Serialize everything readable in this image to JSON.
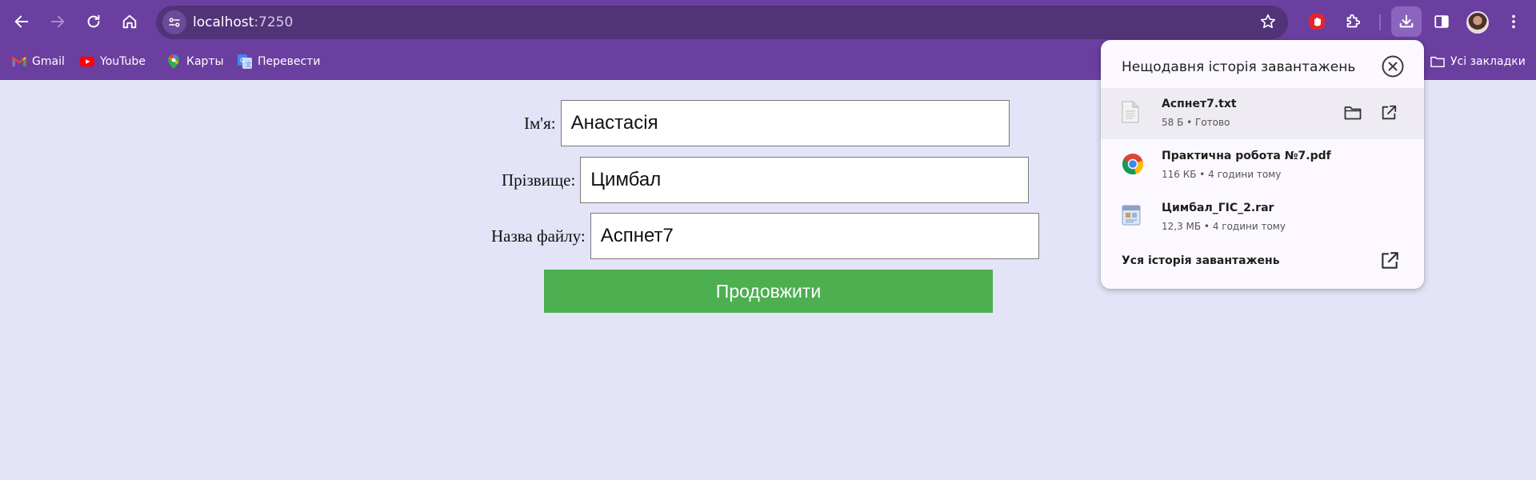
{
  "browser": {
    "url_host": "localhost",
    "url_port": ":7250",
    "bookmarks": [
      {
        "label": "Gmail",
        "icon": "gmail-icon"
      },
      {
        "label": "YouTube",
        "icon": "youtube-icon"
      },
      {
        "label": "Карты",
        "icon": "maps-icon"
      },
      {
        "label": "Перевести",
        "icon": "translate-icon"
      }
    ],
    "all_bookmarks_label": "Усі закладки",
    "colors": {
      "frame": "#6a3fa0",
      "omnibox": "#513478"
    }
  },
  "form": {
    "first_name": {
      "label": "Ім'я:",
      "value": "Анастасія"
    },
    "last_name": {
      "label": "Прізвище:",
      "value": "Цимбал"
    },
    "file_name": {
      "label": "Назва файлу:",
      "value": "Аспнет7"
    },
    "submit_label": "Продовжити",
    "submit_color": "#4caf50",
    "page_background": "#e4e4f8"
  },
  "downloads": {
    "title": "Нещодавня історія завантажень",
    "items": [
      {
        "name": "Аспнет7.txt",
        "meta": "58 Б • Готово",
        "icon": "text-file-icon"
      },
      {
        "name": "Практична робота №7.pdf",
        "meta": "116 КБ • 4 години тому",
        "icon": "chrome-icon"
      },
      {
        "name": "Цимбал_ГІС_2.rar",
        "meta": "12,3 МБ • 4 години тому",
        "icon": "archive-file-icon"
      }
    ],
    "footer_label": "Уся історія завантажень"
  }
}
